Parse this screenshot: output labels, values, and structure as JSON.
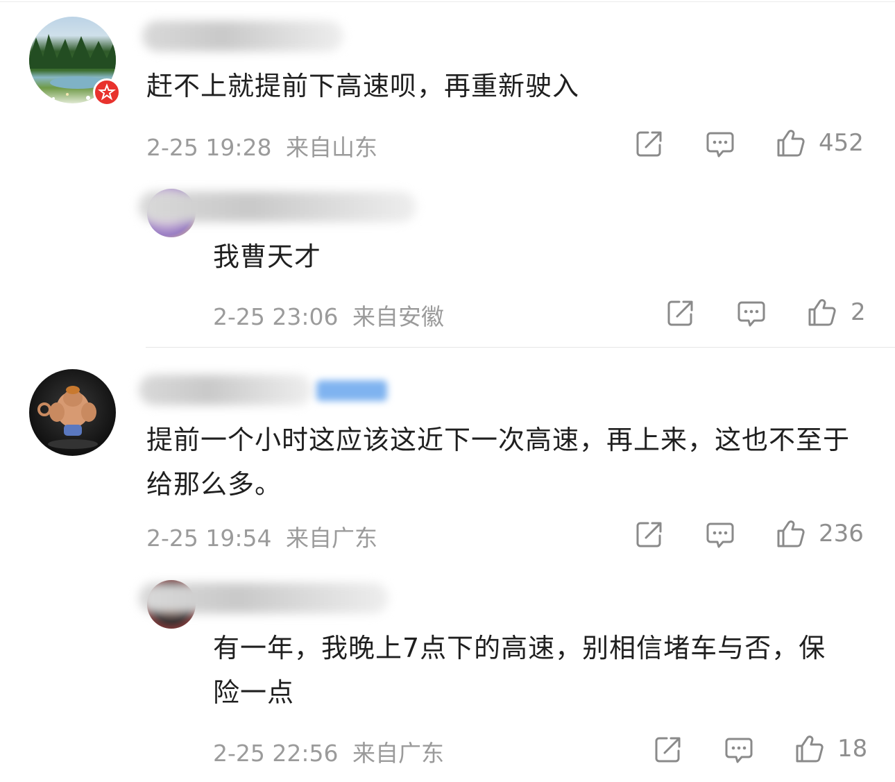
{
  "comments": [
    {
      "text": "赶不上就提前下高速呗，再重新驶入",
      "time": "2-25 19:28",
      "location": "来自山东",
      "likes": "452",
      "replies": [
        {
          "text": "我曹天才",
          "time": "2-25 23:06",
          "location": "来自安徽",
          "likes": "2"
        }
      ]
    },
    {
      "text": "提前一个小时这应该这近下一次高速，再上来，这也不至于给那么多。",
      "time": "2-25 19:54",
      "location": "来自广东",
      "likes": "236",
      "replies": [
        {
          "text": "有一年，我晚上7点下的高速，别相信堵车与否，保险一点",
          "time": "2-25 22:56",
          "location": "来自广东",
          "likes": "18"
        }
      ]
    }
  ],
  "icons": {
    "share": "share-icon",
    "comment": "comment-icon",
    "like": "thumbs-up-icon",
    "badge": "red-star-badge-icon"
  },
  "colors": {
    "meta_gray": "#9b9b9b",
    "badge_red": "#e8322d",
    "verified_blue": "#5b9ef0"
  }
}
